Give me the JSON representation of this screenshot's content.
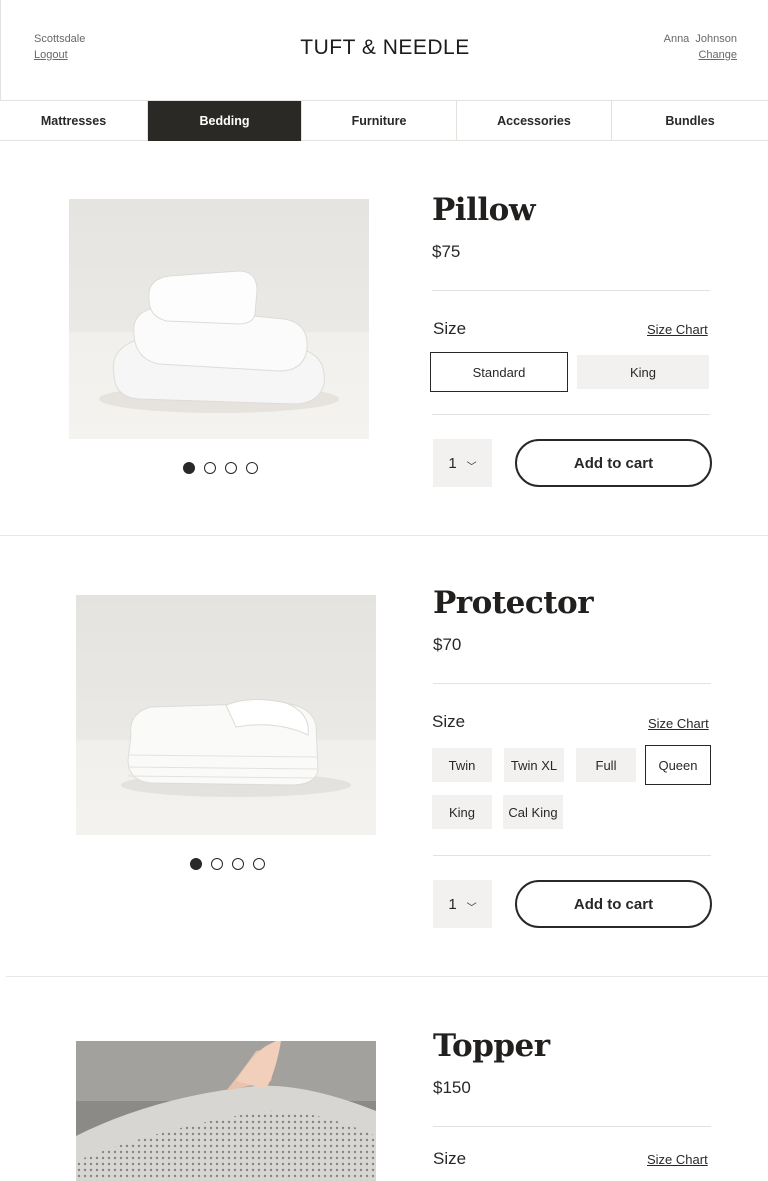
{
  "header": {
    "store_name": "Scottsdale",
    "logout_label": "Logout",
    "logo": "TUFT & NEEDLE",
    "user_name": "Anna  Johnson",
    "change_label": "Change"
  },
  "nav": {
    "items": [
      {
        "label": "Mattresses"
      },
      {
        "label": "Bedding"
      },
      {
        "label": "Furniture"
      },
      {
        "label": "Accessories"
      },
      {
        "label": "Bundles"
      }
    ],
    "active": "Bedding"
  },
  "products": [
    {
      "title": "Pillow",
      "price": "$75",
      "size_label": "Size",
      "size_chart_label": "Size Chart",
      "sizes": [
        "Standard",
        "King"
      ],
      "selected_size": "Standard",
      "quantity": "1",
      "add_to_cart": "Add to cart",
      "carousel_active": 1,
      "carousel_count": 4
    },
    {
      "title": "Protector",
      "price": "$70",
      "size_label": "Size",
      "size_chart_label": "Size Chart",
      "sizes": [
        "Twin",
        "Twin XL",
        "Full",
        "Queen",
        "King",
        "Cal King"
      ],
      "selected_size": "Queen",
      "quantity": "1",
      "add_to_cart": "Add to cart",
      "carousel_active": 1,
      "carousel_count": 4
    },
    {
      "title": "Topper",
      "price": "$150",
      "size_label": "Size",
      "size_chart_label": "Size Chart"
    }
  ],
  "colors": {
    "text": "#2a2826",
    "nav_active_bg": "#2b2926",
    "option_bg": "#f2f1f0",
    "divider": "#e4e2df"
  }
}
